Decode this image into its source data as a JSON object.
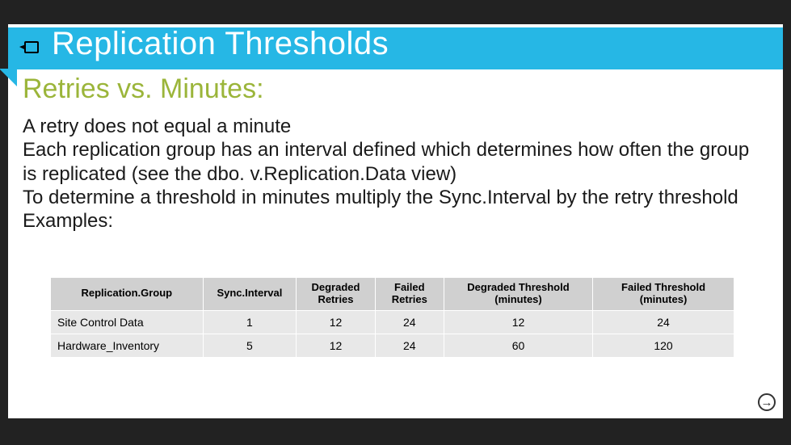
{
  "title": "Replication Thresholds",
  "subtitle": "Retries vs. Minutes:",
  "body": {
    "p1": "A retry does not equal a minute",
    "p2": "Each replication group has an interval defined which determines how often the group is replicated (see the dbo. v.Replication.Data view)",
    "p3": "To determine a threshold in minutes multiply the Sync.Interval by the retry threshold",
    "p4": "Examples:"
  },
  "table": {
    "headers": {
      "c0": "Replication.Group",
      "c1": "Sync.Interval",
      "c2": "Degraded Retries",
      "c3": "Failed Retries",
      "c4": "Degraded Threshold (minutes)",
      "c5": "Failed Threshold (minutes)"
    },
    "rows": [
      {
        "c0": "Site Control Data",
        "c1": "1",
        "c2": "12",
        "c3": "24",
        "c4": "12",
        "c5": "24"
      },
      {
        "c0": "Hardware_Inventory",
        "c1": "5",
        "c2": "12",
        "c3": "24",
        "c4": "60",
        "c5": "120"
      }
    ]
  },
  "chart_data": {
    "type": "table",
    "title": "Replication Thresholds — Retries vs. Minutes",
    "columns": [
      "Replication.Group",
      "Sync.Interval",
      "Degraded Retries",
      "Failed Retries",
      "Degraded Threshold (minutes)",
      "Failed Threshold (minutes)"
    ],
    "rows": [
      [
        "Site Control Data",
        1,
        12,
        24,
        12,
        24
      ],
      [
        "Hardware_Inventory",
        5,
        12,
        24,
        60,
        120
      ]
    ]
  },
  "nav": {
    "next_glyph": "→"
  }
}
